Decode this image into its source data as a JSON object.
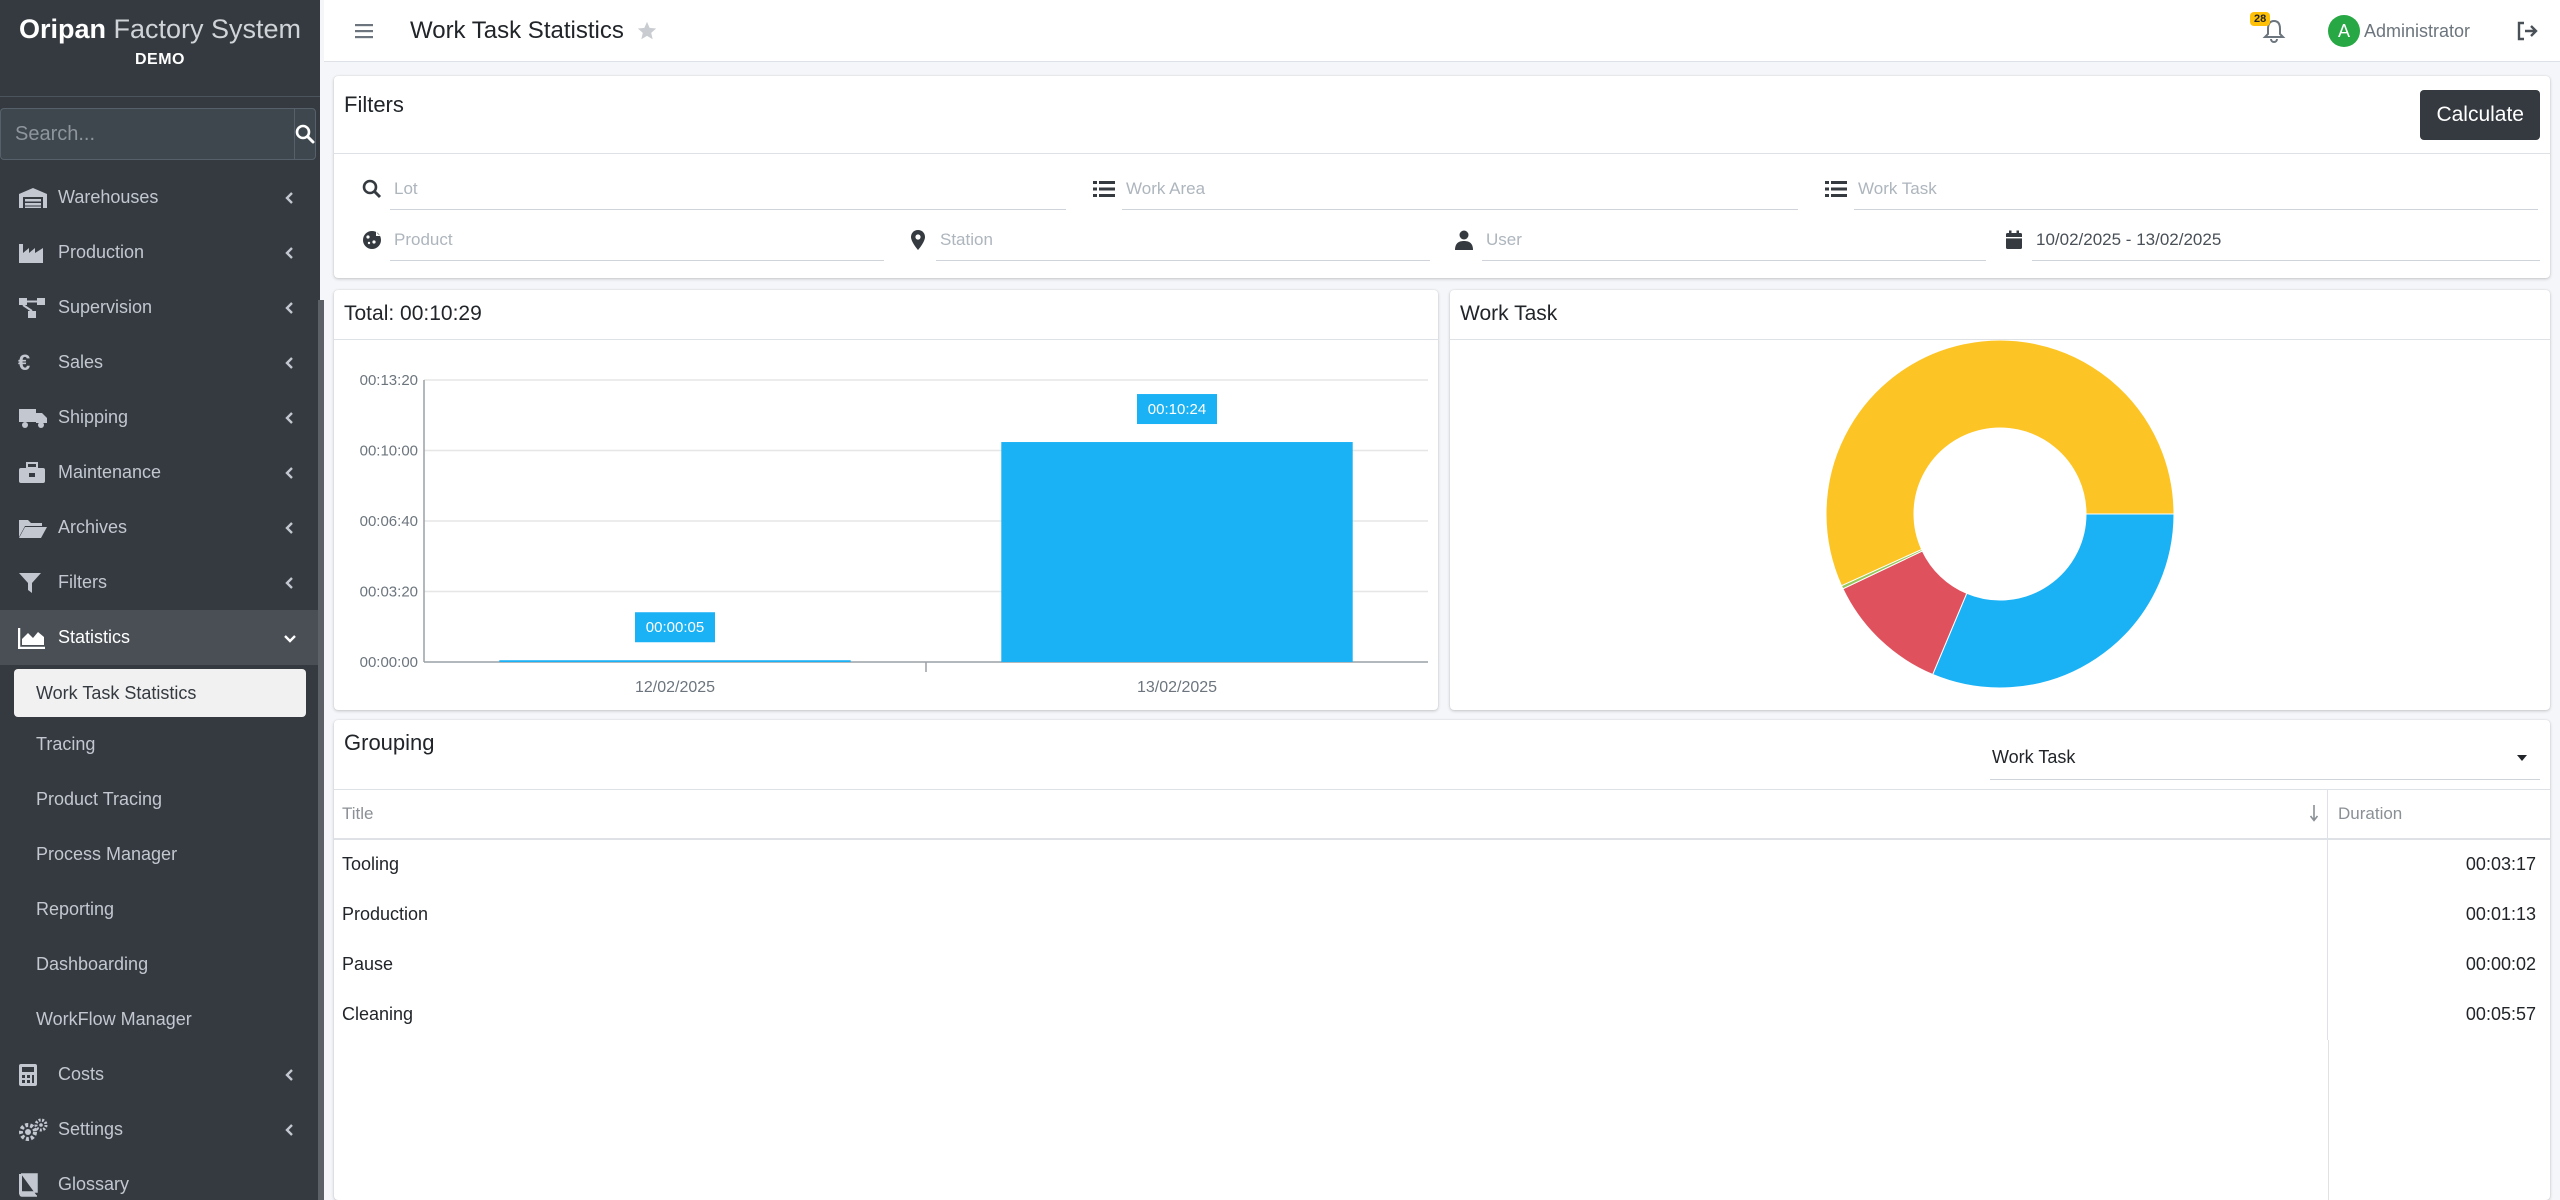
{
  "sidebar": {
    "brand_name_bold": "Oripan",
    "brand_name_rest": " Factory System",
    "brand_sub": "DEMO",
    "search_placeholder": "Search...",
    "items": [
      {
        "label": "Warehouses",
        "icon": "warehouse-icon"
      },
      {
        "label": "Production",
        "icon": "industry-icon"
      },
      {
        "label": "Supervision",
        "icon": "network-icon"
      },
      {
        "label": "Sales",
        "icon": "euro-icon"
      },
      {
        "label": "Shipping",
        "icon": "truck-icon"
      },
      {
        "label": "Maintenance",
        "icon": "toolbox-icon"
      },
      {
        "label": "Archives",
        "icon": "folder-open-icon"
      },
      {
        "label": "Filters",
        "icon": "filter-icon"
      },
      {
        "label": "Statistics",
        "icon": "chart-area-icon"
      }
    ],
    "sub_items": [
      "Work Task Statistics",
      "Tracing",
      "Product Tracing",
      "Process Manager",
      "Reporting",
      "Dashboarding",
      "WorkFlow Manager"
    ],
    "bottom_items": [
      {
        "label": "Costs",
        "icon": "calculator-icon"
      },
      {
        "label": "Settings",
        "icon": "cogs-icon"
      },
      {
        "label": "Glossary",
        "icon": "book-icon"
      }
    ]
  },
  "header": {
    "title": "Work Task Statistics",
    "notification_count": "28",
    "avatar_letter": "A",
    "user_name": "Administrator"
  },
  "filters": {
    "title": "Filters",
    "calculate_label": "Calculate",
    "lot_placeholder": "Lot",
    "work_area_placeholder": "Work Area",
    "work_task_placeholder": "Work Task",
    "product_placeholder": "Product",
    "station_placeholder": "Station",
    "user_placeholder": "User",
    "date_range": "10/02/2025 - 13/02/2025"
  },
  "bar_chart": {
    "title": "Total: 00:10:29"
  },
  "pie_chart": {
    "title": "Work Task"
  },
  "chart_data": [
    {
      "type": "bar",
      "categories": [
        "12/02/2025",
        "13/02/2025"
      ],
      "values": [
        5,
        624
      ],
      "value_labels": [
        "00:00:05",
        "00:10:24"
      ],
      "ylim": [
        0,
        800
      ],
      "yticks": [
        0,
        200,
        400,
        600,
        800
      ],
      "ytick_labels": [
        "00:00:00",
        "00:03:20",
        "00:06:40",
        "00:10:00",
        "00:13:20"
      ],
      "color": "#1ab2f5",
      "grid": true
    },
    {
      "type": "pie",
      "donut": true,
      "categories": [
        "Tooling",
        "Production",
        "Pause",
        "Cleaning"
      ],
      "values": [
        197,
        73,
        2,
        357
      ],
      "colors": [
        "#1ab2f5",
        "#e0515e",
        "#96c95a",
        "#fdc425"
      ]
    }
  ],
  "grouping": {
    "title": "Grouping",
    "selected": "Work Task",
    "col_title": "Title",
    "col_duration": "Duration",
    "rows": [
      {
        "title": "Tooling",
        "duration": "00:03:17"
      },
      {
        "title": "Production",
        "duration": "00:01:13"
      },
      {
        "title": "Pause",
        "duration": "00:00:02"
      },
      {
        "title": "Cleaning",
        "duration": "00:05:57"
      }
    ]
  },
  "colors": {
    "sidebar_bg": "#343a40",
    "accent_dark": "#343a40",
    "bar_blue": "#1ab2f5",
    "badge_yellow": "#ffc107",
    "avatar_green": "#28a745"
  }
}
